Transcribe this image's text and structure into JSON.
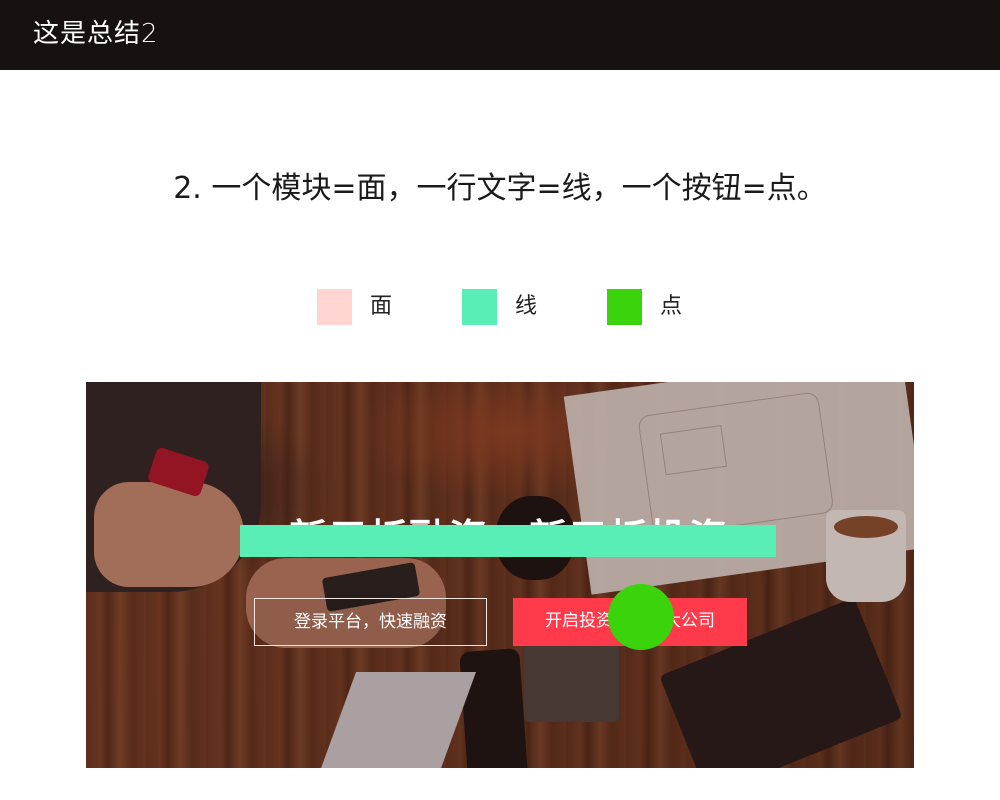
{
  "header": {
    "title": "这是总结2"
  },
  "headline": "2. 一个模块=面，一行文字=线，一个按钮=点。",
  "legend": [
    {
      "label": "面",
      "color": "#ffd4d1"
    },
    {
      "label": "线",
      "color": "#5aeeb7"
    },
    {
      "label": "点",
      "color": "#3ad30c"
    }
  ],
  "hero": {
    "title": "新三板融资，新三板投资",
    "buttons": {
      "login": "登录平台，快速融资",
      "invest": "开启投资，投资大公司"
    }
  }
}
